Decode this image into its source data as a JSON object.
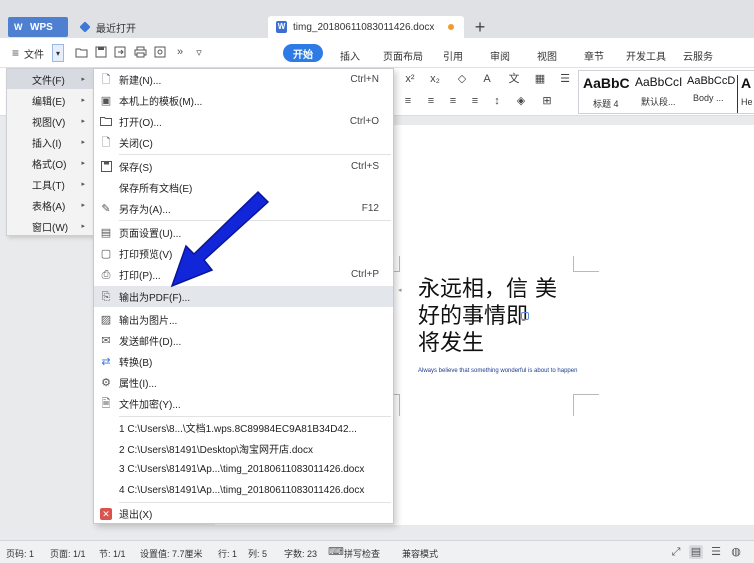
{
  "tabs": {
    "wps": "WPS",
    "recent": "最近打开",
    "doc": "timg_20180611083011426.docx",
    "add": "+"
  },
  "toolbar": {
    "menu_label": "文件",
    "dropdown": "▾",
    "more": "»",
    "ribbon_tabs": [
      "开始",
      "插入",
      "页面布局",
      "引用",
      "审阅",
      "视图",
      "章节",
      "开发工具",
      "云服务"
    ]
  },
  "styles": [
    {
      "sample": "AaBbC",
      "name": "标题 4"
    },
    {
      "sample": "AaBbCcI",
      "name": "默认段..."
    },
    {
      "sample": "AaBbCcD",
      "name": "Body ..."
    },
    {
      "sample": "A",
      "name": "He"
    }
  ],
  "left_menu": [
    {
      "label": "文件(F)",
      "active": true
    },
    {
      "label": "编辑(E)"
    },
    {
      "label": "视图(V)"
    },
    {
      "label": "插入(I)"
    },
    {
      "label": "格式(O)"
    },
    {
      "label": "工具(T)"
    },
    {
      "label": "表格(A)"
    },
    {
      "label": "窗口(W)"
    }
  ],
  "file_menu": {
    "new": {
      "label": "新建(N)...",
      "shortcut": "Ctrl+N",
      "icon": "new-doc-icon"
    },
    "template": {
      "label": "本机上的模板(M)...",
      "icon": "template-icon"
    },
    "open": {
      "label": "打开(O)...",
      "shortcut": "Ctrl+O",
      "icon": "folder-icon"
    },
    "close": {
      "label": "关闭(C)",
      "icon": "close-doc-icon"
    },
    "save": {
      "label": "保存(S)",
      "shortcut": "Ctrl+S",
      "icon": "save-icon"
    },
    "save_all": {
      "label": "保存所有文档(E)"
    },
    "save_as": {
      "label": "另存为(A)...",
      "shortcut": "F12",
      "icon": "save-as-icon"
    },
    "page_setup": {
      "label": "页面设置(U)...",
      "icon": "page-setup-icon"
    },
    "preview": {
      "label": "打印预览(V)",
      "icon": "print-preview-icon"
    },
    "print": {
      "label": "打印(P)...",
      "shortcut": "Ctrl+P",
      "icon": "print-icon"
    },
    "export_pdf": {
      "label": "输出为PDF(F)...",
      "icon": "pdf-icon"
    },
    "export_image": {
      "label": "输出为图片...",
      "icon": "image-icon"
    },
    "send_mail": {
      "label": "发送邮件(D)...",
      "icon": "mail-icon"
    },
    "convert": {
      "label": "转换(B)",
      "icon": "convert-icon"
    },
    "properties": {
      "label": "属性(I)...",
      "icon": "properties-icon"
    },
    "encrypt": {
      "label": "文件加密(Y)...",
      "icon": "encrypt-icon"
    },
    "recent": [
      "1 C:\\Users\\8...\\文档1.wps.8C89984EC9A81B34D42...",
      "2 C:\\Users\\81491\\Desktop\\淘宝网开店.docx",
      "3 C:\\Users\\81491\\Ap...\\timg_20180611083011426.docx",
      "4 C:\\Users\\81491\\Ap...\\timg_20180611083011426.docx"
    ],
    "exit": {
      "label": "退出(X)",
      "icon": "exit-icon"
    }
  },
  "document": {
    "lines": [
      "永远相，信 美",
      "好的事情即",
      "将发生"
    ],
    "subtitle": "Always believe that something wonderful is about to happen"
  },
  "status": {
    "page_num": "页码: 1",
    "pages": "页面: 1/1",
    "section": "节: 1/1",
    "setting": "设置值: 7.7厘米",
    "row": "行: 1",
    "col": "列: 5",
    "words": "字数: 23",
    "spell": "拼写检查",
    "compat": "兼容模式"
  },
  "colors": {
    "accent": "#2e7be6",
    "arrow": "#1126d9"
  }
}
